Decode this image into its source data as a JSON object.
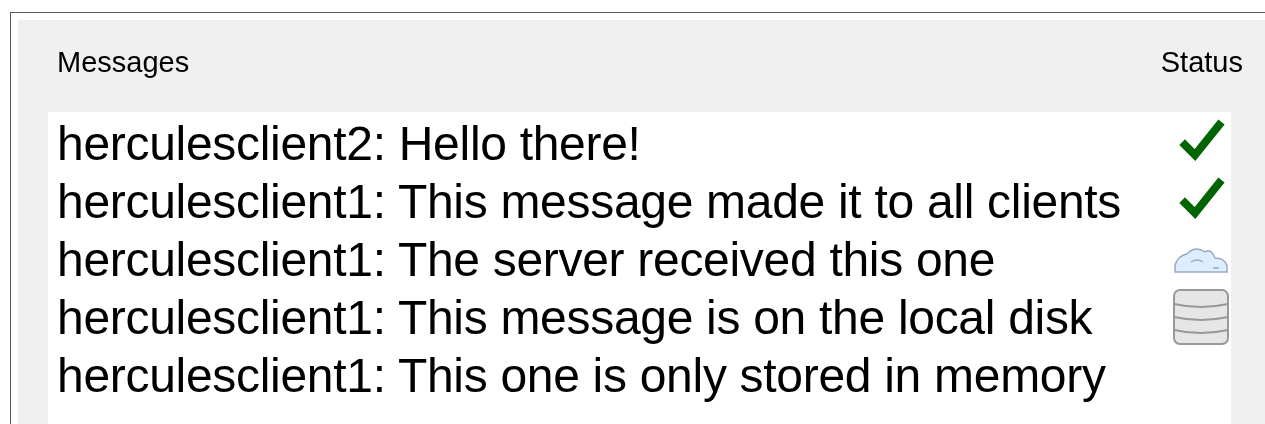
{
  "header": {
    "messages_label": "Messages",
    "status_label": "Status"
  },
  "messages": [
    {
      "text": "herculesclient2: Hello there!",
      "kind": "delivered"
    },
    {
      "text": "herculesclient1: This message made it to all clients",
      "kind": "delivered"
    },
    {
      "text": "herculesclient1: The server received this one",
      "kind": "server"
    },
    {
      "text": "herculesclient1: This message is on the local disk",
      "kind": "disk"
    },
    {
      "text": "herculesclient1: This one is only stored in memory",
      "kind": "memory"
    }
  ]
}
